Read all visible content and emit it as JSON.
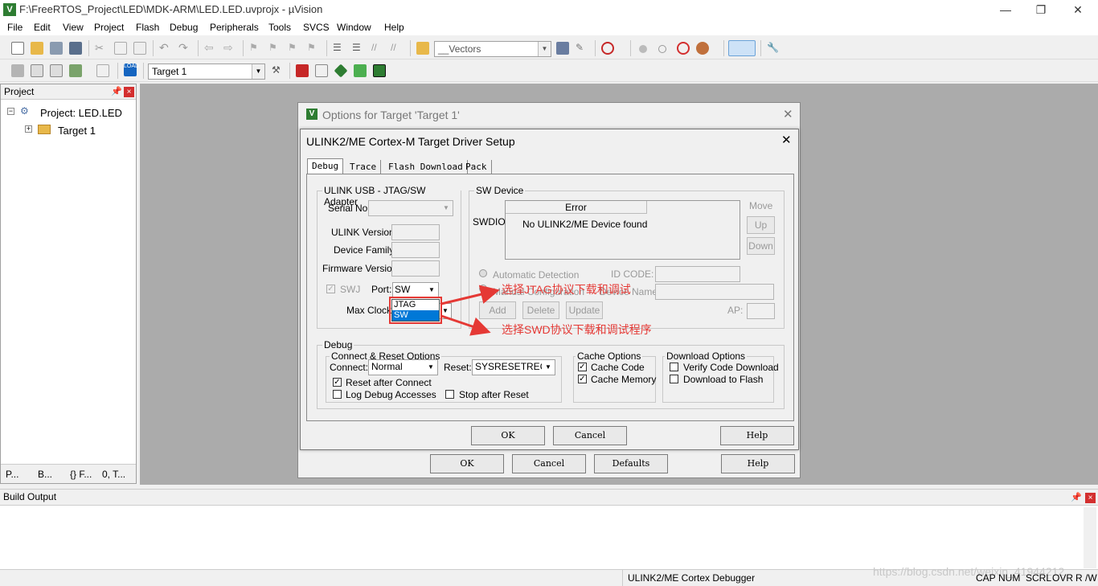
{
  "window": {
    "title": "F:\\FreeRTOS_Project\\LED\\MDK-ARM\\LED.LED.uvprojx - µVision",
    "minimize": "—",
    "restore": "❐",
    "close": "✕"
  },
  "menu": [
    "File",
    "Edit",
    "View",
    "Project",
    "Flash",
    "Debug",
    "Peripherals",
    "Tools",
    "SVCS",
    "Window",
    "Help"
  ],
  "toolbar": {
    "vectors_combo": "__Vectors",
    "target_combo": "Target 1"
  },
  "project_pane": {
    "title": "Project",
    "root": "Project: LED.LED",
    "child": "Target 1",
    "tabs": [
      "P...",
      "B...",
      "{} F...",
      "0, T..."
    ]
  },
  "build_pane": {
    "title": "Build Output"
  },
  "status": {
    "debugger": "ULINK2/ME Cortex Debugger",
    "indicators": [
      "CAP",
      "NUM",
      "SCRL",
      "OVR",
      "R /W"
    ],
    "watermark": "https://blog.csdn.net/weixin_41944212"
  },
  "outer_dialog": {
    "title": "Options for Target 'Target 1'",
    "ok": "OK",
    "cancel": "Cancel",
    "defaults": "Defaults",
    "help": "Help"
  },
  "inner_dialog": {
    "title": "ULINK2/ME Cortex-M Target Driver Setup",
    "tabs": [
      "Debug",
      "Trace",
      "Flash Download",
      "Pack"
    ],
    "adapter": {
      "group": "ULINK USB - JTAG/SW Adapter",
      "serial_no": "Serial No:",
      "ulink_version": "ULINK Version:",
      "device_family": "Device Family:",
      "firmware_version": "Firmware Version:",
      "swj": "SWJ",
      "port": "Port:",
      "port_value": "SW",
      "options": [
        "JTAG",
        "SW"
      ],
      "max_clock": "Max Clock:"
    },
    "sw_device": {
      "group": "SW Device",
      "swdio": "SWDIO",
      "col_error": "Error",
      "message": "No ULINK2/ME Device found",
      "move": "Move",
      "up": "Up",
      "down": "Down",
      "auto": "Automatic Detection",
      "manual": "Manual Configuration",
      "id_code": "ID CODE:",
      "device_name": "Device Name:",
      "add": "Add",
      "delete": "Delete",
      "update": "Update",
      "ap": "AP:"
    },
    "debug": {
      "group": "Debug",
      "connect_group": "Connect & Reset Options",
      "connect": "Connect:",
      "connect_value": "Normal",
      "reset": "Reset:",
      "reset_value": "SYSRESETREQ",
      "reset_after": "Reset after Connect",
      "log_debug": "Log Debug Accesses",
      "stop_after": "Stop after Reset",
      "cache_group": "Cache Options",
      "cache_code": "Cache Code",
      "cache_memory": "Cache Memory",
      "download_group": "Download Options",
      "verify": "Verify Code Download",
      "download_flash": "Download to Flash"
    },
    "ok": "OK",
    "cancel": "Cancel",
    "help": "Help"
  },
  "annotations": {
    "jtag": "选择JTAG协议下载和调试",
    "swd": "选择SWD协议下载和调试程序"
  },
  "colors": {
    "annotation": "#e53935",
    "selection": "#0078d7",
    "workspace": "#ababab"
  }
}
